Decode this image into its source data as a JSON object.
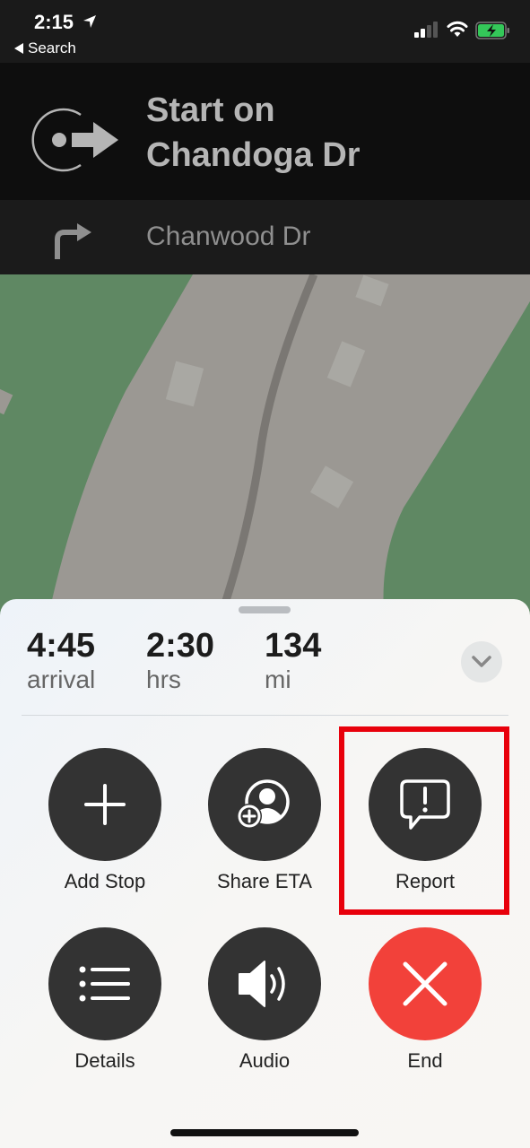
{
  "status_bar": {
    "time": "2:15",
    "back_label": "Search",
    "icons": [
      "location-arrow-icon",
      "cellular-signal-icon",
      "wifi-icon",
      "battery-charging-icon"
    ],
    "battery_color": "#34c759"
  },
  "navigation": {
    "current_instruction": "Start on Chandoga Dr",
    "current_line1": "Start on",
    "current_line2": "Chandoga Dr",
    "current_icon": "start-route-icon",
    "next_street": "Chanwood Dr",
    "next_icon": "turn-right-icon"
  },
  "trip": {
    "arrival": {
      "value": "4:45",
      "unit": "arrival"
    },
    "duration": {
      "value": "2:30",
      "unit": "hrs"
    },
    "distance": {
      "value": "134",
      "unit": "mi"
    },
    "collapse_icon": "chevron-down-icon"
  },
  "actions": [
    {
      "label": "Add Stop",
      "icon": "plus-icon"
    },
    {
      "label": "Share ETA",
      "icon": "share-eta-icon"
    },
    {
      "label": "Report",
      "icon": "report-icon"
    },
    {
      "label": "Details",
      "icon": "list-icon"
    },
    {
      "label": "Audio",
      "icon": "speaker-icon"
    },
    {
      "label": "End",
      "icon": "close-icon"
    }
  ],
  "colors": {
    "end_button": "#f2413a",
    "highlight": "#e8000b",
    "map_green": "#5f8863",
    "map_road": "#9b9893"
  }
}
